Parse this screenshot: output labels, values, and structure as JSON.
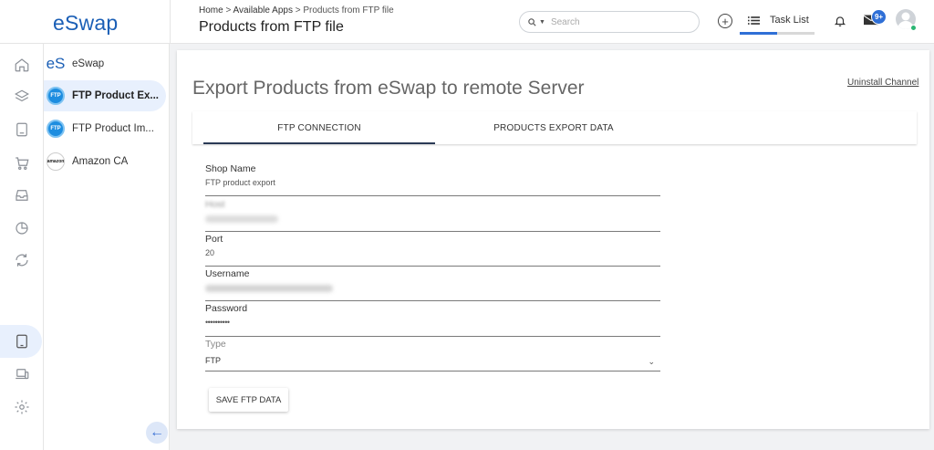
{
  "brand": {
    "logo_text": "eSwap",
    "accent": "#1b5fb6"
  },
  "rail": {
    "icons": [
      "home-icon",
      "layers-icon",
      "book-icon",
      "cart-icon",
      "inbox-icon",
      "pie-chart-icon",
      "sync-icon",
      "tablet-icon",
      "laptop-icon",
      "settings-icon"
    ],
    "active": "tablet-icon"
  },
  "apps": {
    "items": [
      {
        "label": "eSwap",
        "icon": "eswap-logo-icon"
      },
      {
        "label": "FTP Product Ex...",
        "icon": "ftp-icon",
        "active": true
      },
      {
        "label": "FTP Product Im...",
        "icon": "ftp-icon"
      },
      {
        "label": "Amazon CA",
        "icon": "amazon-icon"
      }
    ],
    "ftp_icon_text": "FTP",
    "amazon_icon_text": "amazon"
  },
  "header": {
    "breadcrumb": [
      "Home",
      "Available Apps",
      "Products from FTP file"
    ],
    "breadcrumb_sep": ">",
    "title": "Products from FTP file",
    "search_placeholder": "Search",
    "tasklist_label": "Task List",
    "notifications_badge": "9+",
    "tasklist_progress": 0.5
  },
  "main": {
    "heading": "Export Products from eSwap to remote Server",
    "uninstall_label": "Uninstall Channel",
    "tabs": [
      {
        "label": "FTP CONNECTION",
        "active": true
      },
      {
        "label": "PRODUCTS EXPORT DATA",
        "active": false
      }
    ],
    "fields": {
      "shop_name": {
        "label": "Shop Name",
        "value": "FTP product export"
      },
      "host": {
        "label": "Host"
      },
      "port": {
        "label": "Port",
        "value": "20"
      },
      "username": {
        "label": "Username"
      },
      "password": {
        "label": "Password",
        "value": "••••••••••"
      },
      "type": {
        "label": "Type",
        "value": "FTP"
      }
    },
    "save_label": "SAVE FTP DATA"
  }
}
